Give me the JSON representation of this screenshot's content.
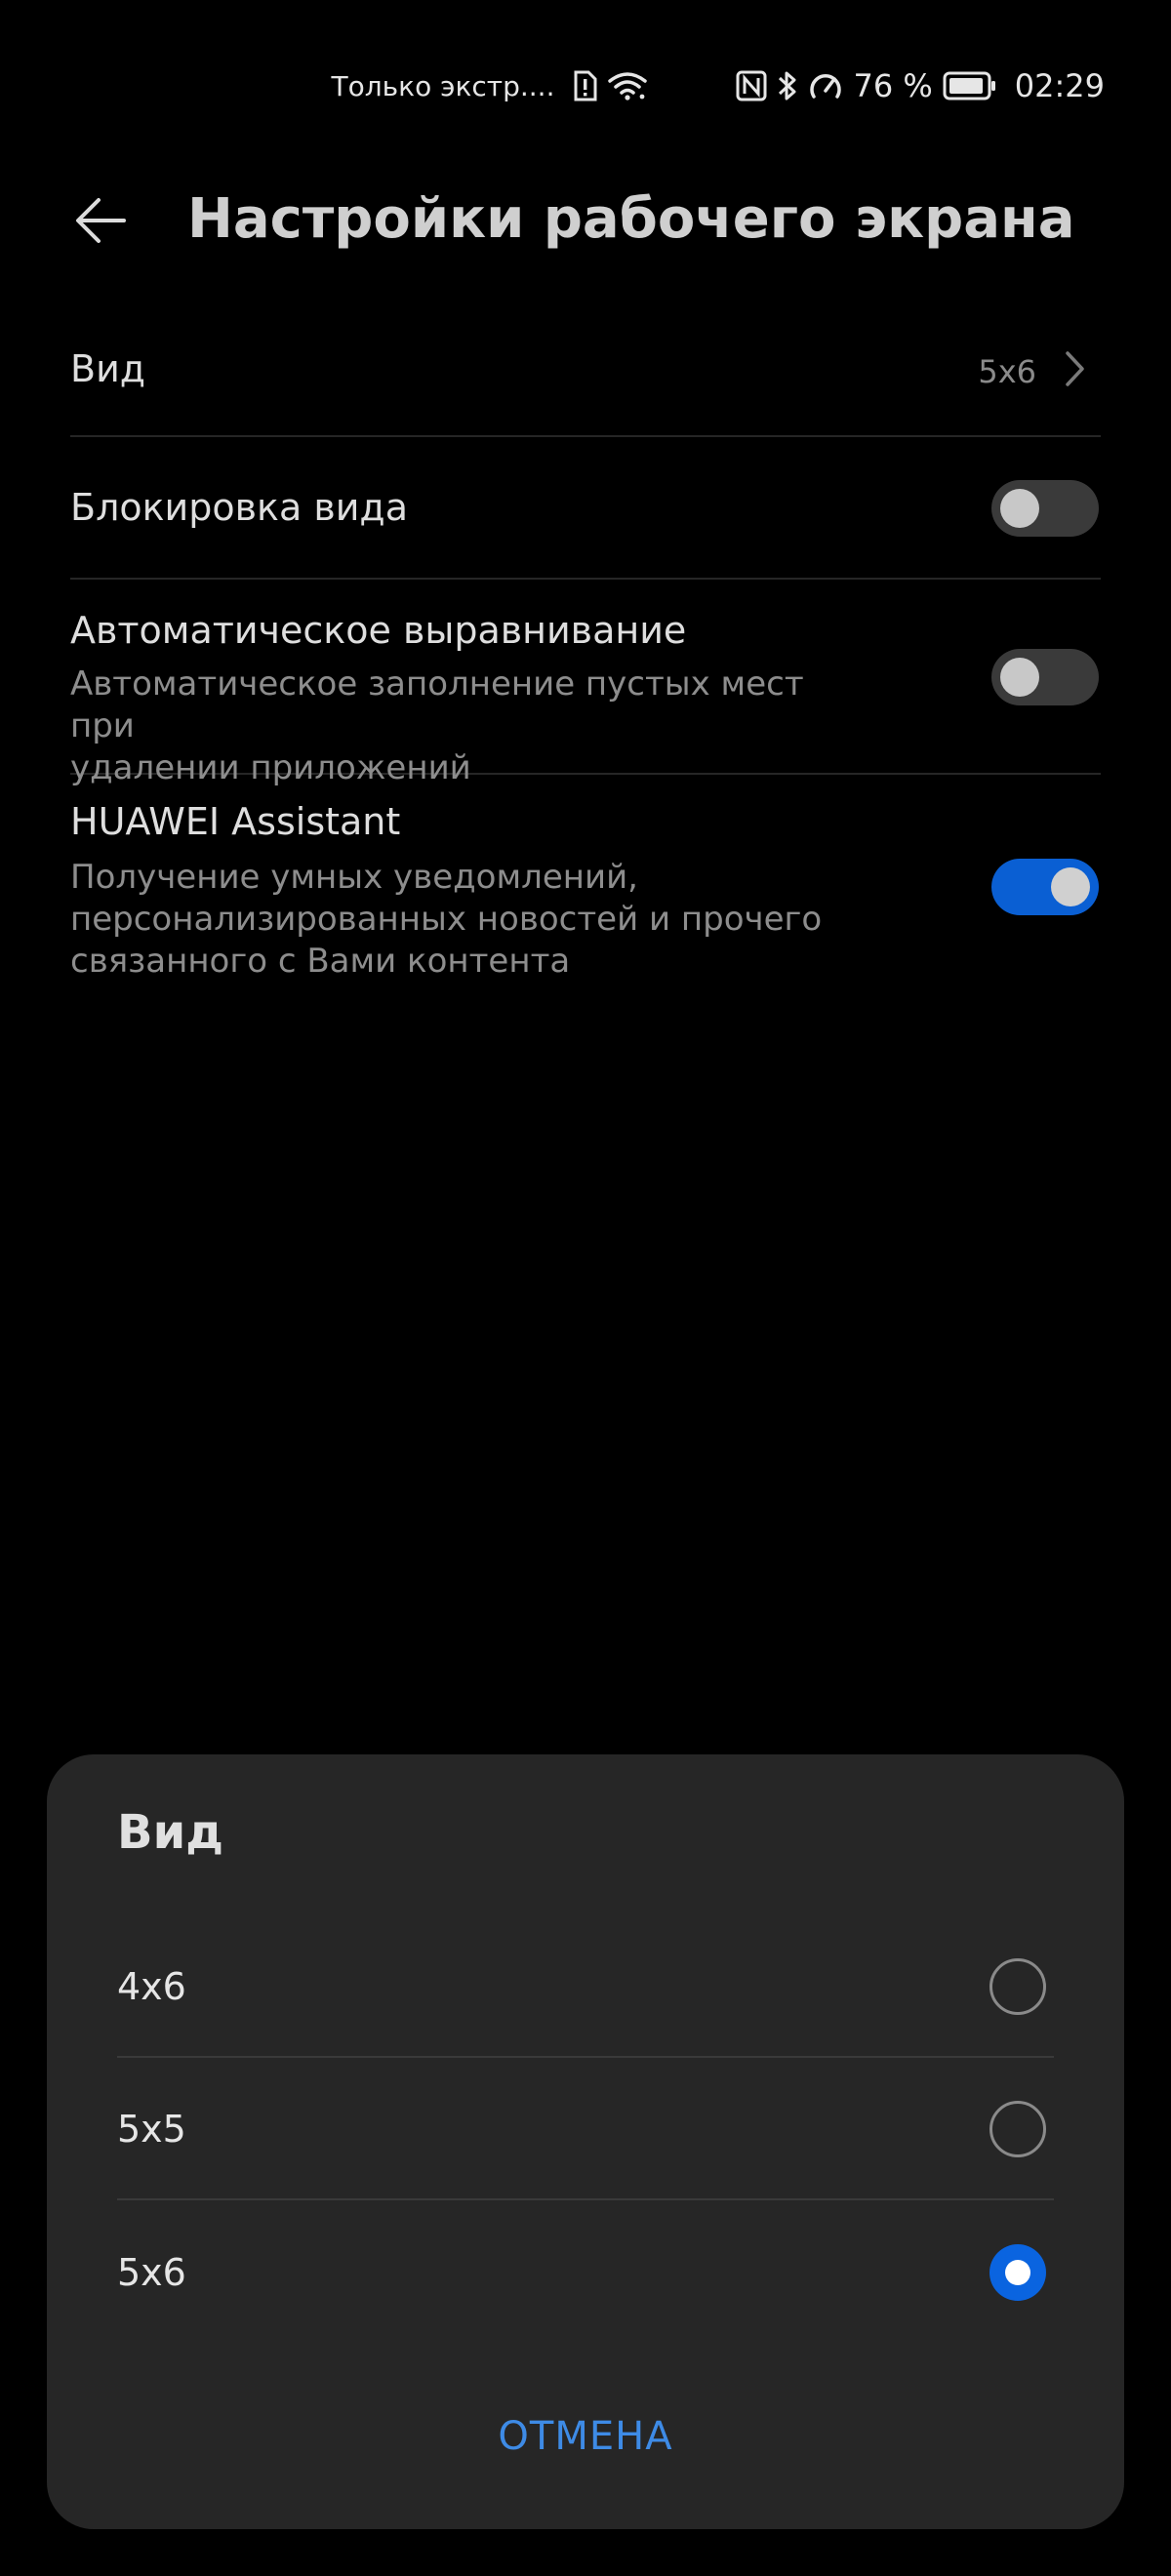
{
  "status_bar": {
    "carrier": "Только экстр....",
    "battery_percent": "76 %",
    "time": "02:29",
    "icons": [
      "sim-alert-icon",
      "wifi-icon",
      "nfc-icon",
      "bluetooth-icon",
      "speedometer-icon",
      "battery-icon"
    ]
  },
  "header": {
    "title": "Настройки рабочего экрана",
    "back_icon": "arrow-left-icon"
  },
  "settings": {
    "view": {
      "label": "Вид",
      "value": "5x6"
    },
    "lock_layout": {
      "label": "Блокировка вида",
      "enabled": false
    },
    "auto_align": {
      "label": "Автоматическое выравнивание",
      "description_line1": "Автоматическое заполнение пустых мест при",
      "description_line2": "удалении приложений",
      "enabled": false
    },
    "assistant": {
      "label": "HUAWEI Assistant",
      "description_line1": "Получение умных уведомлений,",
      "description_line2": "персонализированных новостей и прочего",
      "description_line3": "связанного с Вами контента",
      "enabled": true
    }
  },
  "dialog": {
    "title": "Вид",
    "options": [
      {
        "label": "4x6",
        "selected": false
      },
      {
        "label": "5x5",
        "selected": false
      },
      {
        "label": "5x6",
        "selected": true
      }
    ],
    "cancel_label": "ОТМЕНА"
  },
  "colors": {
    "accent": "#0a64e0",
    "cancel_text": "#3e8be6",
    "background": "#000000",
    "dialog_background": "#262626"
  }
}
